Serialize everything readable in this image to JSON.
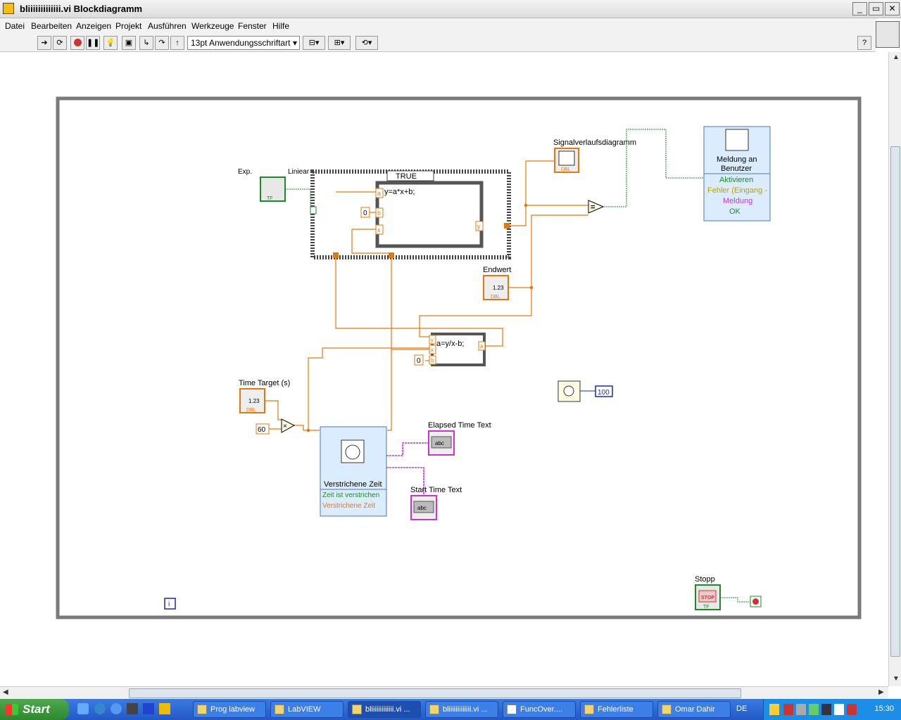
{
  "window": {
    "title": "bliiiiiiiiiiiii.vi Blockdiagramm",
    "btn_min": "_",
    "btn_restore": "▭",
    "btn_close": "✕"
  },
  "menu": {
    "items": [
      "Datei",
      "Bearbeiten",
      "Anzeigen",
      "Projekt",
      "Ausführen",
      "Werkzeuge",
      "Fenster",
      "Hilfe"
    ]
  },
  "toolbar": {
    "font_select": "13pt Anwendungsschriftart",
    "help_label": "?"
  },
  "diagram": {
    "exp_label": "Exp.",
    "liniear_label": "Liniear",
    "case_selector": "TRUE",
    "formula1": "y=a*x+b;",
    "formula1_inputs": [
      "a",
      "b",
      "x"
    ],
    "formula1_output": "y",
    "const_zero_1": "0",
    "formula2": "a=y/x-b;",
    "formula2_inputs": [
      "y",
      "x",
      "b"
    ],
    "formula2_output": "a",
    "const_zero_2": "0",
    "signal_label": "Signalverlaufsdiagramm",
    "endwert_label": "Endwert",
    "numeric_text": "1.23",
    "dbl_tag": "DBL",
    "tf_tag": "TF",
    "abc_tag": "abc",
    "compare_symbol": "=",
    "dialog": {
      "title_line1": "Meldung an",
      "title_line2": "Benutzer",
      "rows": [
        "Aktivieren",
        "Fehler (Eingang -",
        "Meldung",
        "OK"
      ]
    },
    "time_target_label": "Time Target (s)",
    "const_60": "60",
    "multiply_symbol": "×",
    "elapsed_block": {
      "title": "Verstrichene Zeit",
      "rows": [
        "Zeit ist verstrichen",
        "Verstrichene Zeit"
      ]
    },
    "elapsed_text_label": "Elapsed Time Text",
    "start_text_label": "Start Time Text",
    "wait_const": "100",
    "stop_label": "Stopp",
    "stop_button_text": "STOP",
    "iteration_label": "i"
  },
  "taskbar": {
    "start_label": "Start",
    "tasks": [
      "Prog labview",
      "LabVIEW",
      "bliiiiiiiiiiiii.vi ...",
      "bliiiiiiiiiiiii.vi ...",
      "FuncOver....",
      "Fehlerliste",
      "Omar Dahir"
    ],
    "lang": "DE",
    "clock": "15:30"
  },
  "colors": {
    "orange_wire": "#e07a10",
    "green_wire": "#1a8a2a",
    "pink_wire": "#d030d0",
    "blue_const": "#1a2aa8",
    "frame_gray": "#7a7a7a"
  }
}
